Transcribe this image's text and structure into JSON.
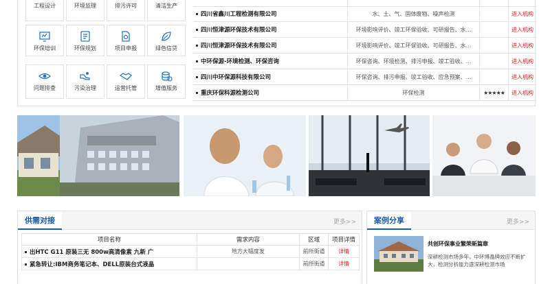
{
  "services": [
    {
      "label": "工程设计",
      "icon": "draft-icon"
    },
    {
      "label": "环境监理",
      "icon": "eye-monitor-icon"
    },
    {
      "label": "排污许可",
      "icon": "permit-icon"
    },
    {
      "label": "清洁生产",
      "icon": "gear-icon"
    },
    {
      "label": "环保培训",
      "icon": "screen-icon"
    },
    {
      "label": "环保规划",
      "icon": "plan-icon"
    },
    {
      "label": "项目申报",
      "icon": "document-icon"
    },
    {
      "label": "绿色信贷",
      "icon": "leaf-icon"
    },
    {
      "label": "问题排查",
      "icon": "eye-icon"
    },
    {
      "label": "污染治理",
      "icon": "hand-icon"
    },
    {
      "label": "运营托管",
      "icon": "handshake-icon"
    },
    {
      "label": "增值服务",
      "icon": "coins-icon"
    }
  ],
  "institutions": [
    {
      "name": "四川省鑫川工程检测有限公司",
      "scope": "水、土、气、固体废物、噪声检测",
      "stars": "",
      "action": "进入机构"
    },
    {
      "name": "四川恒津源环保技术有限公司",
      "scope": "环境影响评价、竣工环保验收、可研报告、水...",
      "stars": "",
      "action": "进入机构"
    },
    {
      "name": "四川恒津源环保技术有限公司",
      "scope": "环境影响评价、竣工环保验收、可研报告、水...",
      "stars": "",
      "action": "进入机构"
    },
    {
      "name": "中环保源-环境检测、环保咨询",
      "scope": "环保咨询、环境检测、排污申报、竣工验收、...",
      "stars": "",
      "action": "进入机构"
    },
    {
      "name": "四川中环保源科技有限公司",
      "scope": "环保咨询、排污申报、竣工验收、应急预案、...",
      "stars": "",
      "action": "进入机构"
    },
    {
      "name": "重庆环保科源检测公司",
      "scope": "环保检测",
      "stars": "★★★★★",
      "action": "进入机构"
    }
  ],
  "supply": {
    "title": "供需对接",
    "more": "更多>>",
    "headers": [
      "项目名称",
      "需求内容",
      "区域",
      "项目详情"
    ],
    "rows": [
      {
        "name": "出HTC G11 原装三无 800w高清像素 九新 广",
        "content": "地方大幅度发",
        "region": "前所街道",
        "detail": "详情"
      },
      {
        "name": "紧急转让:IBM商务笔记本、DELL原装台式液晶",
        "content": "",
        "region": "前所街道",
        "detail": "详情"
      }
    ]
  },
  "cases": {
    "title": "案例分享",
    "more": "更多>>",
    "item_title": "共创环保事业繁荣新篇章",
    "item_desc": "深耕检测市场多年，中环博晶牌效应不断扩大，检测分析能力逐深耕检测市场"
  },
  "colors": {
    "accent": "#1a5aa8",
    "icon": "#2a78c8",
    "link_red": "#e02020"
  }
}
